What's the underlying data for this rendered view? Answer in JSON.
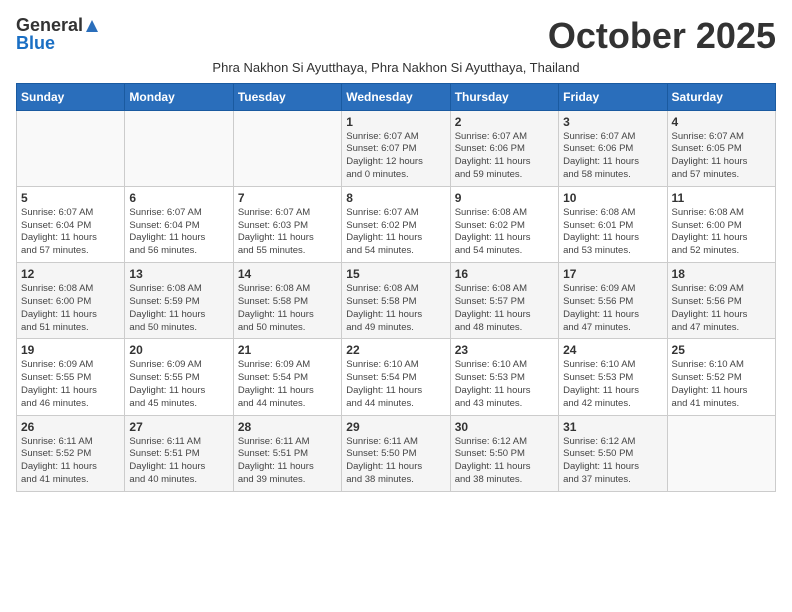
{
  "logo": {
    "general": "General",
    "blue": "Blue"
  },
  "title": "October 2025",
  "subtitle": "Phra Nakhon Si Ayutthaya, Phra Nakhon Si Ayutthaya, Thailand",
  "days_of_week": [
    "Sunday",
    "Monday",
    "Tuesday",
    "Wednesday",
    "Thursday",
    "Friday",
    "Saturday"
  ],
  "weeks": [
    [
      {
        "day": "",
        "info": ""
      },
      {
        "day": "",
        "info": ""
      },
      {
        "day": "",
        "info": ""
      },
      {
        "day": "1",
        "info": "Sunrise: 6:07 AM\nSunset: 6:07 PM\nDaylight: 12 hours\nand 0 minutes."
      },
      {
        "day": "2",
        "info": "Sunrise: 6:07 AM\nSunset: 6:06 PM\nDaylight: 11 hours\nand 59 minutes."
      },
      {
        "day": "3",
        "info": "Sunrise: 6:07 AM\nSunset: 6:06 PM\nDaylight: 11 hours\nand 58 minutes."
      },
      {
        "day": "4",
        "info": "Sunrise: 6:07 AM\nSunset: 6:05 PM\nDaylight: 11 hours\nand 57 minutes."
      }
    ],
    [
      {
        "day": "5",
        "info": "Sunrise: 6:07 AM\nSunset: 6:04 PM\nDaylight: 11 hours\nand 57 minutes."
      },
      {
        "day": "6",
        "info": "Sunrise: 6:07 AM\nSunset: 6:04 PM\nDaylight: 11 hours\nand 56 minutes."
      },
      {
        "day": "7",
        "info": "Sunrise: 6:07 AM\nSunset: 6:03 PM\nDaylight: 11 hours\nand 55 minutes."
      },
      {
        "day": "8",
        "info": "Sunrise: 6:07 AM\nSunset: 6:02 PM\nDaylight: 11 hours\nand 54 minutes."
      },
      {
        "day": "9",
        "info": "Sunrise: 6:08 AM\nSunset: 6:02 PM\nDaylight: 11 hours\nand 54 minutes."
      },
      {
        "day": "10",
        "info": "Sunrise: 6:08 AM\nSunset: 6:01 PM\nDaylight: 11 hours\nand 53 minutes."
      },
      {
        "day": "11",
        "info": "Sunrise: 6:08 AM\nSunset: 6:00 PM\nDaylight: 11 hours\nand 52 minutes."
      }
    ],
    [
      {
        "day": "12",
        "info": "Sunrise: 6:08 AM\nSunset: 6:00 PM\nDaylight: 11 hours\nand 51 minutes."
      },
      {
        "day": "13",
        "info": "Sunrise: 6:08 AM\nSunset: 5:59 PM\nDaylight: 11 hours\nand 50 minutes."
      },
      {
        "day": "14",
        "info": "Sunrise: 6:08 AM\nSunset: 5:58 PM\nDaylight: 11 hours\nand 50 minutes."
      },
      {
        "day": "15",
        "info": "Sunrise: 6:08 AM\nSunset: 5:58 PM\nDaylight: 11 hours\nand 49 minutes."
      },
      {
        "day": "16",
        "info": "Sunrise: 6:08 AM\nSunset: 5:57 PM\nDaylight: 11 hours\nand 48 minutes."
      },
      {
        "day": "17",
        "info": "Sunrise: 6:09 AM\nSunset: 5:56 PM\nDaylight: 11 hours\nand 47 minutes."
      },
      {
        "day": "18",
        "info": "Sunrise: 6:09 AM\nSunset: 5:56 PM\nDaylight: 11 hours\nand 47 minutes."
      }
    ],
    [
      {
        "day": "19",
        "info": "Sunrise: 6:09 AM\nSunset: 5:55 PM\nDaylight: 11 hours\nand 46 minutes."
      },
      {
        "day": "20",
        "info": "Sunrise: 6:09 AM\nSunset: 5:55 PM\nDaylight: 11 hours\nand 45 minutes."
      },
      {
        "day": "21",
        "info": "Sunrise: 6:09 AM\nSunset: 5:54 PM\nDaylight: 11 hours\nand 44 minutes."
      },
      {
        "day": "22",
        "info": "Sunrise: 6:10 AM\nSunset: 5:54 PM\nDaylight: 11 hours\nand 44 minutes."
      },
      {
        "day": "23",
        "info": "Sunrise: 6:10 AM\nSunset: 5:53 PM\nDaylight: 11 hours\nand 43 minutes."
      },
      {
        "day": "24",
        "info": "Sunrise: 6:10 AM\nSunset: 5:53 PM\nDaylight: 11 hours\nand 42 minutes."
      },
      {
        "day": "25",
        "info": "Sunrise: 6:10 AM\nSunset: 5:52 PM\nDaylight: 11 hours\nand 41 minutes."
      }
    ],
    [
      {
        "day": "26",
        "info": "Sunrise: 6:11 AM\nSunset: 5:52 PM\nDaylight: 11 hours\nand 41 minutes."
      },
      {
        "day": "27",
        "info": "Sunrise: 6:11 AM\nSunset: 5:51 PM\nDaylight: 11 hours\nand 40 minutes."
      },
      {
        "day": "28",
        "info": "Sunrise: 6:11 AM\nSunset: 5:51 PM\nDaylight: 11 hours\nand 39 minutes."
      },
      {
        "day": "29",
        "info": "Sunrise: 6:11 AM\nSunset: 5:50 PM\nDaylight: 11 hours\nand 38 minutes."
      },
      {
        "day": "30",
        "info": "Sunrise: 6:12 AM\nSunset: 5:50 PM\nDaylight: 11 hours\nand 38 minutes."
      },
      {
        "day": "31",
        "info": "Sunrise: 6:12 AM\nSunset: 5:50 PM\nDaylight: 11 hours\nand 37 minutes."
      },
      {
        "day": "",
        "info": ""
      }
    ]
  ]
}
